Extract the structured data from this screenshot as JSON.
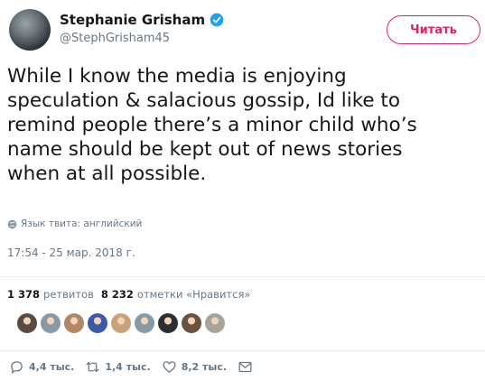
{
  "author": {
    "name": "Stephanie Grisham",
    "handle": "@StephGrisham45",
    "avatar_icon": "user-avatar",
    "verified_icon": "verified-badge-icon"
  },
  "follow_button": {
    "label": "Читать"
  },
  "tweet": {
    "text": "While I know the media is enjoying\nspeculation & salacious gossip, Id like to\nremind people there’s a minor child who’s\nname should be kept out of news stories\nwhen at all possible.",
    "language_note": "Язык твита: английский",
    "timestamp": "17:54 - 25 мар. 2018 г."
  },
  "stats": {
    "retweets_count": "1 378",
    "retweets_label": "ретвитов",
    "likes_count": "8 232",
    "likes_label": "отметки «Нравится»"
  },
  "likers": [
    {
      "name": "liker-avatar-1",
      "color": "#5b4a3f"
    },
    {
      "name": "liker-avatar-2",
      "color": "#8899a6"
    },
    {
      "name": "liker-avatar-3",
      "color": "#b08866"
    },
    {
      "name": "liker-avatar-4",
      "color": "#3a5aa8"
    },
    {
      "name": "liker-avatar-5",
      "color": "#c9a27a"
    },
    {
      "name": "liker-avatar-6",
      "color": "#8899a6"
    },
    {
      "name": "liker-avatar-7",
      "color": "#2a2e32"
    },
    {
      "name": "liker-avatar-8",
      "color": "#6d5140"
    },
    {
      "name": "liker-avatar-9",
      "color": "#a7a49a"
    }
  ],
  "actions": {
    "reply_count": "4,4 тыс.",
    "retweet_count": "1,4 тыс.",
    "like_count": "8,2 тыс."
  },
  "colors": {
    "accent": "#e0245e",
    "verified": "#1da1f2",
    "muted": "#657786",
    "text": "#14171a"
  }
}
